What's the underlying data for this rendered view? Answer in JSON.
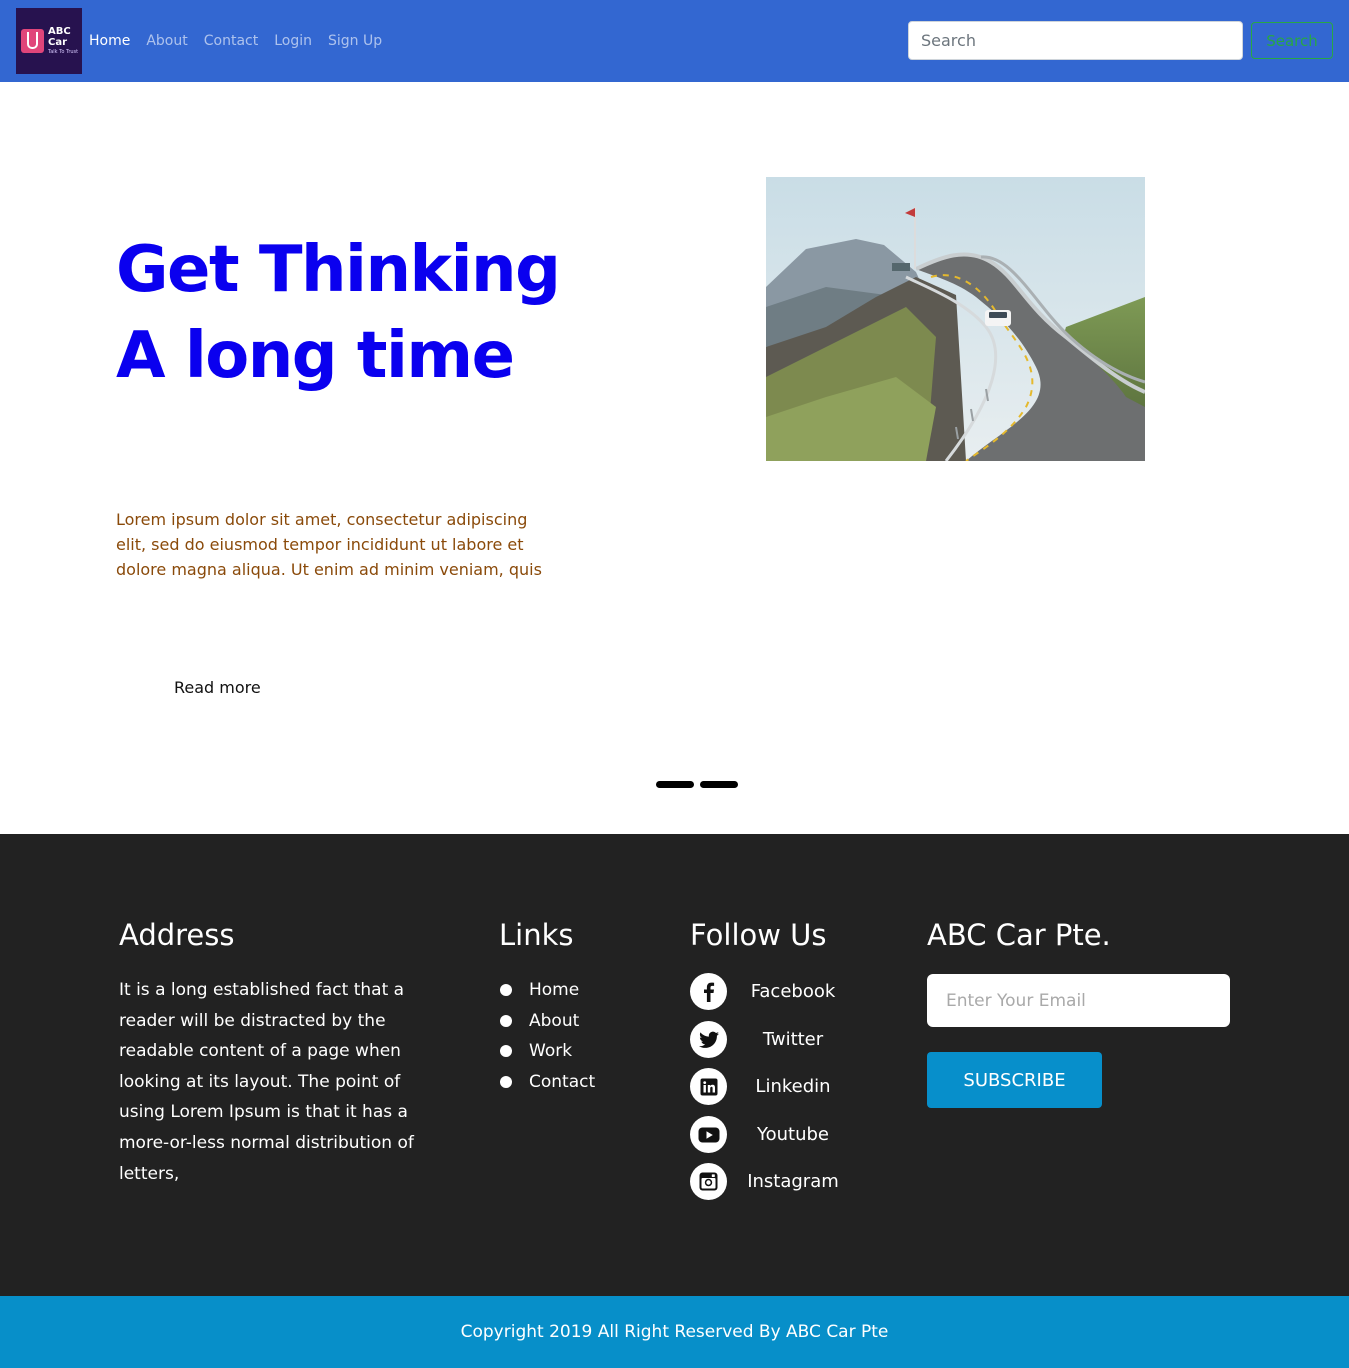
{
  "navbar": {
    "brand": {
      "title": "ABC Car",
      "tagline": "Talk To Trust"
    },
    "links": [
      "Home",
      "About",
      "Contact",
      "Login",
      "Sign Up"
    ],
    "active_link": "Home",
    "search": {
      "placeholder": "Search",
      "button_label": "Search"
    }
  },
  "hero": {
    "title": "Get Thinking A long time",
    "text": "Lorem ipsum dolor sit amet, consectetur adipiscing elit, sed do eiusmod tempor incididunt ut labore et dolore magna aliqua. Ut enim ad minim veniam, quis",
    "read_more": "Read more",
    "carousel_slides": 2
  },
  "footer": {
    "address": {
      "heading": "Address",
      "text": "It is a long established fact that a reader will be distracted by the readable content of a page when looking at its layout. The point of using Lorem Ipsum is that it has a more-or-less normal distribution of letters,"
    },
    "links": {
      "heading": "Links",
      "items": [
        "Home",
        "About",
        "Work",
        "Contact"
      ]
    },
    "follow": {
      "heading": "Follow Us",
      "items": [
        {
          "label": "Facebook",
          "icon": "facebook-icon"
        },
        {
          "label": "Twitter",
          "icon": "twitter-icon"
        },
        {
          "label": "Linkedin",
          "icon": "linkedin-icon"
        },
        {
          "label": "Youtube",
          "icon": "youtube-icon"
        },
        {
          "label": "Instagram",
          "icon": "instagram-icon"
        }
      ]
    },
    "newsletter": {
      "heading": "ABC Car Pte.",
      "email_placeholder": "Enter Your Email",
      "button_label": "SUBSCRIBE"
    }
  },
  "copyright": "Copyright 2019 All Right Reserved By ABC Car Pte",
  "colors": {
    "navbar": "#3367d1",
    "hero_title": "#0a00ef",
    "hero_text": "#8a4a0a",
    "footer": "#222222",
    "accent": "#078fcb",
    "search_button": "#28a745"
  }
}
